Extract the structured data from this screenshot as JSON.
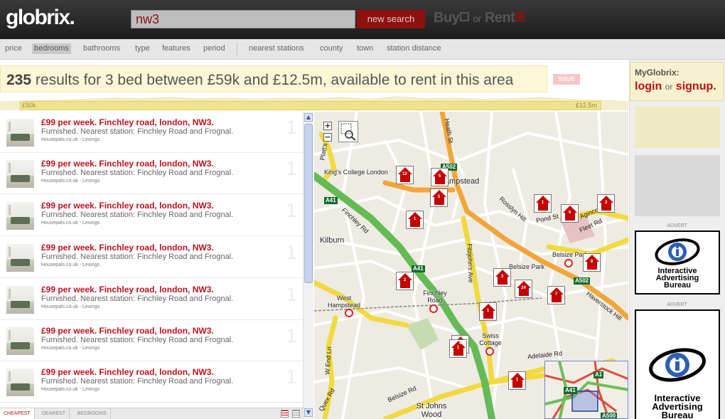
{
  "header": {
    "logo": "globrix.",
    "search_value": "nw3",
    "new_search_label": "new search",
    "buy_label": "Buy",
    "or_label": "or",
    "rent_label": "Rent"
  },
  "filters": [
    "price",
    "bedrooms",
    "bathrooms",
    "type",
    "features",
    "period",
    "nearest stations",
    "county",
    "town",
    "station distance"
  ],
  "active_filter": "bedrooms",
  "summary": {
    "count": "235",
    "text": "results for 3 bed between £59k and £12.5m, available to rent in this area",
    "save_label": "save",
    "min_price": "£50k",
    "max_price": "£12.5m"
  },
  "mygl": {
    "title": "MyGlobrix:",
    "login": "login",
    "or": "or",
    "signup": "signup."
  },
  "ads": [
    {
      "label": "ADVERT",
      "line1": "Interactive",
      "line2": "Advertising",
      "line3": "Bureau"
    },
    {
      "label": "ADVERT",
      "line1": "Interactive",
      "line2": "Advertising",
      "line3": "Bureau"
    }
  ],
  "listings": [
    {
      "title": "£99 per week. Finchley road, london, NW3.",
      "desc": "Furnished. Nearest station: Finchley Road and Frognal.",
      "source": "Housepals.co.uk - Lexings",
      "num": "1"
    },
    {
      "title": "£99 per week. Finchley road, london, NW3.",
      "desc": "Furnished. Nearest station: Finchley Road and Frognal.",
      "source": "Housepals.co.uk - Lexings",
      "num": "1"
    },
    {
      "title": "£99 per week. Finchley road, london, NW3.",
      "desc": "Furnished. Nearest station: Finchley Road and Frognal.",
      "source": "Housepals.co.uk - Lexings",
      "num": "1"
    },
    {
      "title": "£99 per week. Finchley road, london, NW3.",
      "desc": "Furnished. Nearest station: Finchley Road and Frognal.",
      "source": "Housepals.co.uk - Lexings",
      "num": "1"
    },
    {
      "title": "£99 per week. Finchley road, london, NW3.",
      "desc": "Furnished. Nearest station: Finchley Road and Frognal.",
      "source": "Housepals.co.uk - Lexings",
      "num": "1"
    },
    {
      "title": "£99 per week. Finchley road, london, NW3.",
      "desc": "Furnished. Nearest station: Finchley Road and Frognal.",
      "source": "Housepals.co.uk - Lexings",
      "num": "1"
    },
    {
      "title": "£99 per week. Finchley road, london, NW3.",
      "desc": "Furnished. Nearest station: Finchley Road and Frognal.",
      "source": "Housepals.co.uk - Lexings",
      "num": "1"
    }
  ],
  "sort_tabs": [
    "CHEAPEST",
    "DEAREST",
    "BEDROOMS"
  ],
  "map": {
    "places": [
      "King's College London",
      "Hampstead",
      "Kilburn",
      "Belsize Park",
      "Belsize Park",
      "West Hampstead",
      "Finchley Road",
      "Swiss Cottage",
      "St Johns Wood"
    ],
    "roads": [
      "Finchley Rd",
      "Fitzjohn's Ave",
      "Rosslyn Hill",
      "Pond St",
      "Agincourt Rd",
      "Fleet Rd",
      "Haverstock Hill",
      "W End Ln",
      "Adelaide Rd",
      "Belsize Rd",
      "Heath St",
      "Platt's Ln",
      "Quex Rd"
    ],
    "shields": [
      "A502",
      "A41",
      "A41",
      "A502",
      "A41",
      "A1",
      "A500"
    ],
    "markers": [
      "12",
      "5",
      "5",
      "1",
      "1",
      "6",
      "3",
      "8",
      "2",
      "3",
      "24",
      "7",
      "1",
      "4",
      "1",
      "1"
    ],
    "zoom_in": "+",
    "zoom_out": "−"
  }
}
